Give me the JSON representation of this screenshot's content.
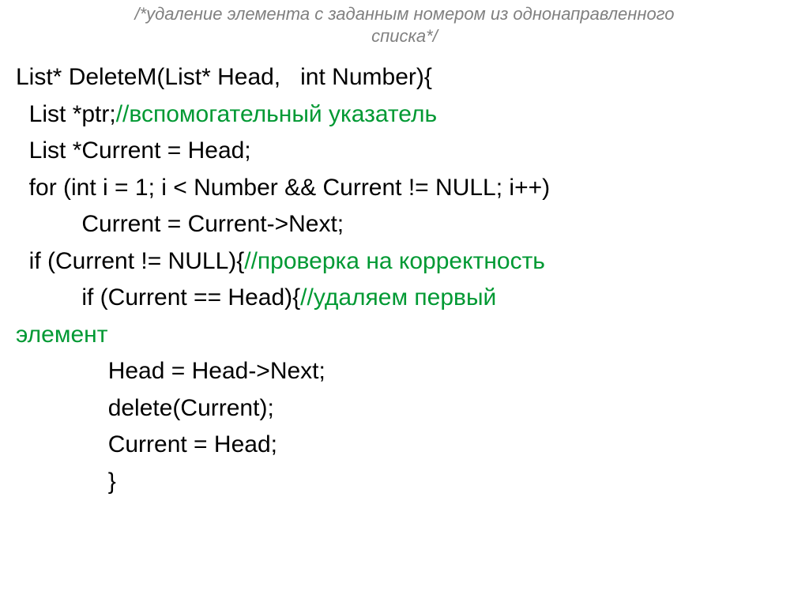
{
  "title_line1": "/*удаление элемента с заданным номером из однонаправленного",
  "title_line2": "списка*/",
  "code": {
    "l1": "List* DeleteM(List* Head,   int Number){",
    "l2a": "  List *ptr;",
    "l2b": "//вспомогательный указатель",
    "l3": "  List *Current = Head;",
    "l4": "  for (int i = 1; i < Number && Current != NULL; i++)",
    "l5": "          Current = Current->Next;",
    "l6a": "  if (Current != NULL){",
    "l6b": "//проверка на корректность",
    "l7a": "          if (Current == Head){",
    "l7b": "//удаляем первый",
    "l7c": "элемент",
    "l8": "              Head = Head->Next;",
    "l9": "              delete(Current);",
    "l10": "              Current = Head;",
    "l11": "              }"
  }
}
